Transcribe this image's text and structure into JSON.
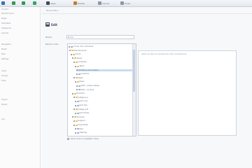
{
  "toolbar": {
    "buttons": [
      {
        "label": "",
        "color": "#3a6fb6",
        "icon": "doc-icon"
      },
      {
        "label": "",
        "color": "#2e9b55",
        "icon": "up-arrow-icon"
      },
      {
        "label": "",
        "color": "#2e9b55",
        "icon": "down-arrow-icon"
      },
      {
        "label": "",
        "color": "#33a36b",
        "icon": "refresh-icon"
      },
      {
        "label": "Save",
        "color": "#3e4a5a",
        "icon": "save-icon"
      },
      {
        "label": "Delete",
        "color": "#c77a2e",
        "icon": "delete-icon"
      },
      {
        "label": "Cancel",
        "color": "#8a97a8",
        "icon": "cancel-icon"
      },
      {
        "label": "Close",
        "color": "#8a97a8",
        "icon": "close-icon"
      }
    ]
  },
  "sidebar": {
    "items": [
      "Content",
      "Site Structure",
      "Pages",
      "Templates",
      "Categories",
      "Layouts",
      "Navigation",
      "Media",
      "Files",
      "Settings",
      "Users",
      "Groups",
      "Tools",
      "Import",
      "Export",
      "Log"
    ]
  },
  "main": {
    "breadcrumb": "Node Editor",
    "title": "Edit",
    "name_label": "Name:",
    "name_value": "Node",
    "parent_label": "Parent node:",
    "preview_text": "Select an item to preview the node contents here"
  },
  "tree": {
    "rows": [
      {
        "label": "(none) root / structure",
        "icon": "doc"
      },
      {
        "label": "Site Structure",
        "icon": "folder"
      },
      {
        "label": "Home",
        "icon": "folder"
      },
      {
        "label": "About",
        "icon": "folder"
      },
      {
        "label": "Company",
        "icon": "folder"
      },
      {
        "label": "Team",
        "icon": "folder"
      },
      {
        "label": "History and mission",
        "icon": "doc",
        "selected": true
      },
      {
        "label": "Contacts",
        "icon": "doc"
      },
      {
        "label": "News",
        "icon": "folder"
      },
      {
        "label": "Press",
        "icon": "folder"
      },
      {
        "label": "2012 - press release",
        "icon": "doc"
      },
      {
        "label": "2011 - archive",
        "icon": "doc"
      },
      {
        "label": "Products",
        "icon": "folder"
      },
      {
        "label": "Category A",
        "icon": "folder"
      },
      {
        "label": "Item one",
        "icon": "doc"
      },
      {
        "label": "Item two",
        "icon": "doc"
      },
      {
        "label": "Category B",
        "icon": "folder"
      },
      {
        "label": "Item three",
        "icon": "doc"
      },
      {
        "label": "Services",
        "icon": "folder"
      },
      {
        "label": "Support",
        "icon": "folder"
      },
      {
        "label": "Downloads",
        "icon": "folder"
      },
      {
        "label": "FAQ",
        "icon": "doc"
      },
      {
        "label": "Sitemap",
        "icon": "doc"
      }
    ]
  },
  "footer": {
    "checkbox_label": "Show node in navigation menu"
  }
}
